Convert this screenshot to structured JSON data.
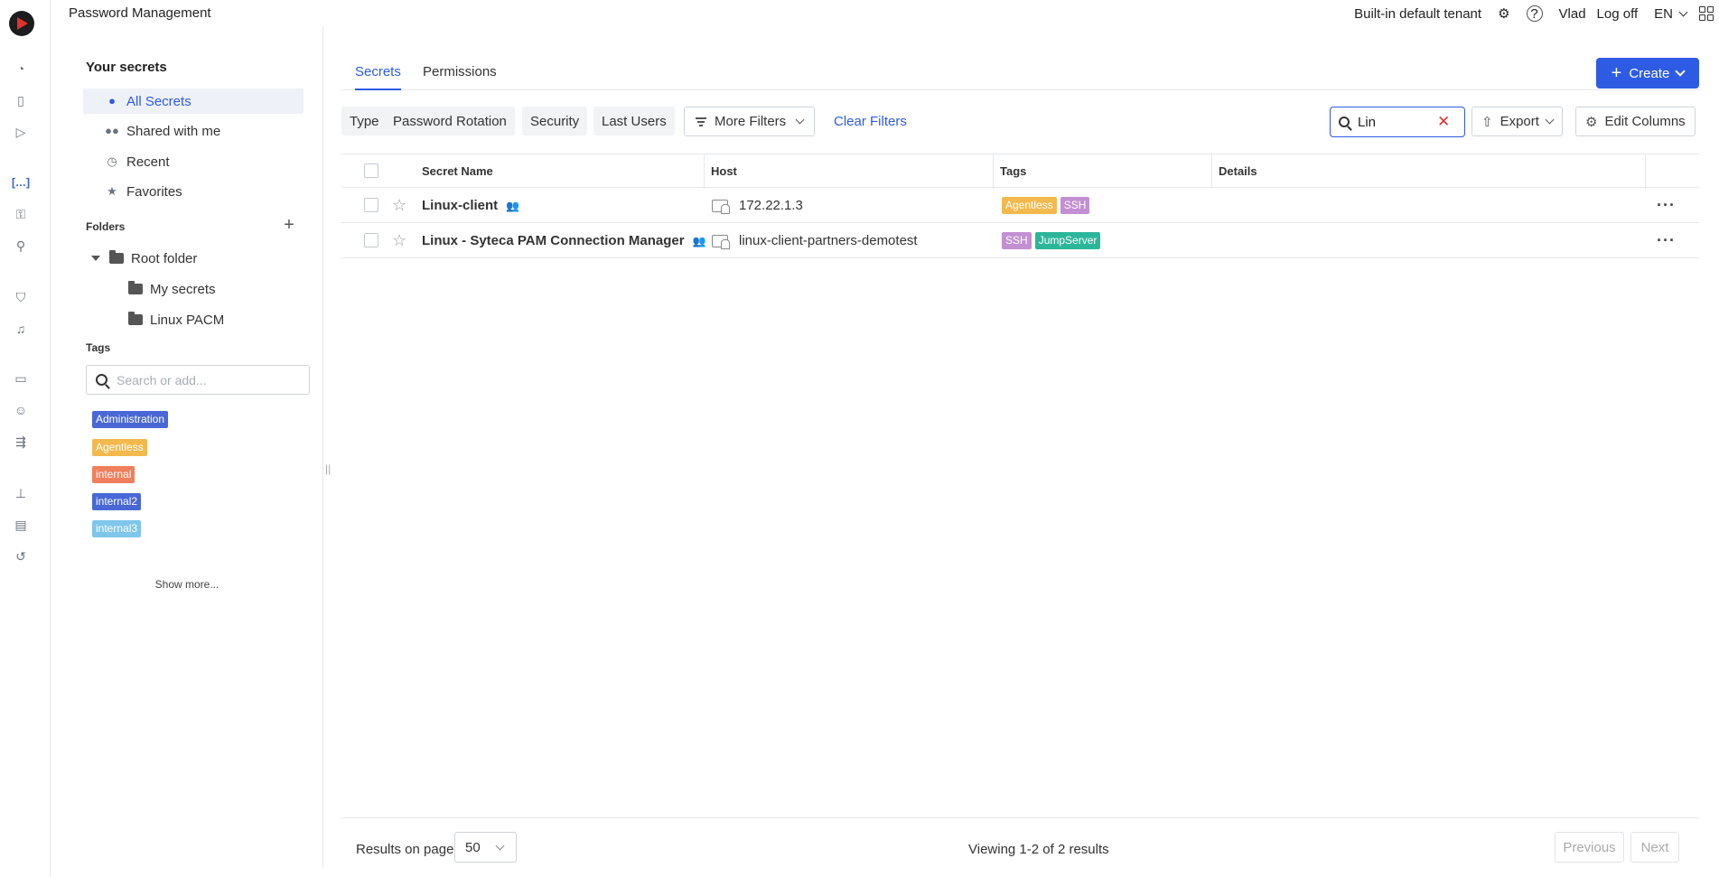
{
  "app": {
    "title": "Password Management"
  },
  "topbar": {
    "tenant": "Built-in default tenant",
    "user": "Vlad",
    "logoff": "Log off",
    "language": "EN"
  },
  "sidebar": {
    "title": "Your secrets",
    "nav": [
      {
        "label": "All Secrets",
        "icon": "user-icon",
        "active": true
      },
      {
        "label": "Shared with me",
        "icon": "users-icon",
        "active": false
      },
      {
        "label": "Recent",
        "icon": "clock-icon",
        "active": false
      },
      {
        "label": "Favorites",
        "icon": "star-icon",
        "active": false
      }
    ],
    "folders_header": "Folders",
    "folders": [
      {
        "label": "Root folder"
      },
      {
        "label": "My secrets"
      },
      {
        "label": "Linux PACM"
      }
    ],
    "tags_header": "Tags",
    "tag_search_placeholder": "Search or add...",
    "tags": [
      {
        "label": "Administration",
        "color": "#4a67d6"
      },
      {
        "label": "Agentless",
        "color": "#f3b94d"
      },
      {
        "label": "internal",
        "color": "#f07f5d"
      },
      {
        "label": "internal2",
        "color": "#4a67d6"
      },
      {
        "label": "internal3",
        "color": "#7fc6ea"
      }
    ],
    "show_more": "Show more..."
  },
  "main": {
    "tabs": [
      {
        "label": "Secrets",
        "active": true
      },
      {
        "label": "Permissions",
        "active": false
      }
    ],
    "create_label": "Create",
    "filters": {
      "type": "Type",
      "password_rotation": "Password Rotation",
      "security": "Security",
      "last_users": "Last Users",
      "more_filters": "More Filters",
      "clear_filters": "Clear Filters"
    },
    "search_value": "Lin",
    "export_label": "Export",
    "edit_columns_label": "Edit Columns",
    "table": {
      "columns": [
        "Secret Name",
        "Host",
        "Tags",
        "Details"
      ],
      "rows": [
        {
          "name": "Linux-client",
          "host": "172.22.1.3",
          "tags": [
            {
              "label": "Agentless",
              "color": "#f3b94d"
            },
            {
              "label": "SSH",
              "color": "#c38fd3"
            }
          ]
        },
        {
          "name": "Linux - Syteca PAM Connection Manager",
          "host": "linux-client-partners-demotest",
          "tags": [
            {
              "label": "SSH",
              "color": "#c38fd3"
            },
            {
              "label": "JumpServer",
              "color": "#2bb69a"
            }
          ]
        }
      ]
    },
    "footer": {
      "results_on_page_label": "Results on page",
      "results_on_page_value": "50",
      "viewing": "Viewing 1-2 of 2 results",
      "previous": "Previous",
      "next": "Next"
    }
  },
  "colors": {
    "accent": "#2d5be3",
    "danger": "#e0322b"
  }
}
